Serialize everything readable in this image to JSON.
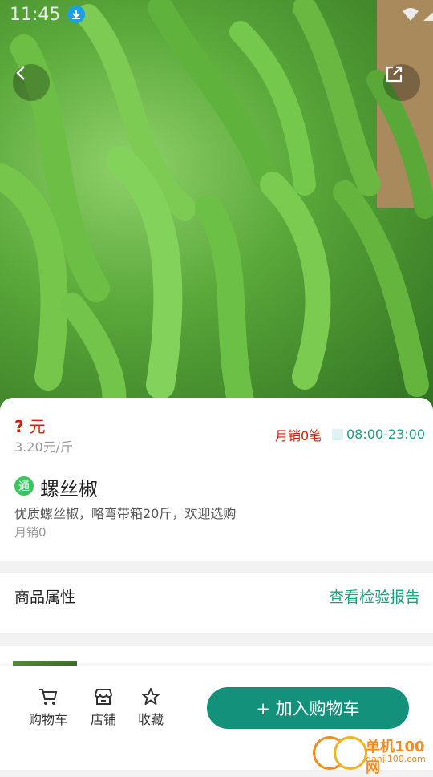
{
  "status_bar": {
    "time": "11:45"
  },
  "product": {
    "price_placeholder": "?",
    "price_currency": "元",
    "unit_price": "3.20元/斤",
    "monthly_sales_right": "月销0笔",
    "business_hours": "08:00-23:00",
    "badge_text": "通",
    "name": "螺丝椒",
    "description": "优质螺丝椒，略弯带箱20斤，欢迎选购",
    "monthly_sales": "月销0"
  },
  "attributes": {
    "label": "商品属性",
    "report_link": "查看检验报告"
  },
  "bottom_bar": {
    "cart_tab": "购物车",
    "store_tab": "店铺",
    "favorite_tab": "收藏",
    "add_to_cart": "+ 加入购物车"
  },
  "watermark": {
    "title": "单机100网",
    "url": "danji100.com"
  },
  "colors": {
    "accent": "#13917a",
    "price_red": "#d81e06",
    "link_green": "#15a37f"
  }
}
